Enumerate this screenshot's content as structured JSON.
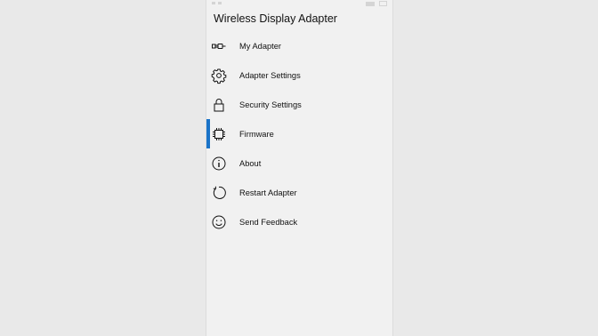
{
  "app": {
    "title": "Wireless Display Adapter"
  },
  "menu": {
    "items": [
      {
        "label": "My Adapter",
        "icon": "adapter-plug-icon",
        "selected": false
      },
      {
        "label": "Adapter Settings",
        "icon": "gear-icon",
        "selected": false
      },
      {
        "label": "Security Settings",
        "icon": "lock-icon",
        "selected": false
      },
      {
        "label": "Firmware",
        "icon": "chip-icon",
        "selected": true
      },
      {
        "label": "About",
        "icon": "info-icon",
        "selected": false
      },
      {
        "label": "Restart Adapter",
        "icon": "restart-icon",
        "selected": false
      },
      {
        "label": "Send Feedback",
        "icon": "smiley-icon",
        "selected": false
      }
    ]
  },
  "colors": {
    "selection_accent": "#1a73c8",
    "page_background": "#e9e9e9",
    "panel_background": "#f1f1f1"
  }
}
